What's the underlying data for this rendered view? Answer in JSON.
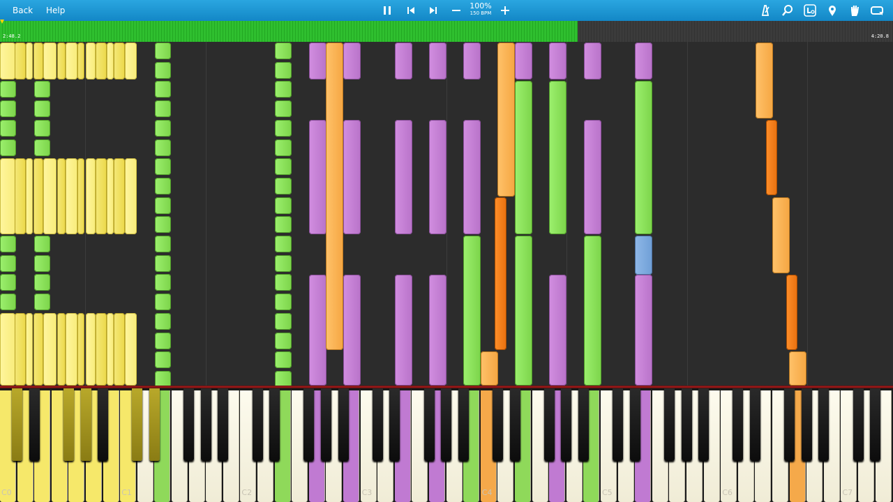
{
  "toolbar": {
    "back_label": "Back",
    "help_label": "Help",
    "speed_percent": "100%",
    "tempo": "150 BPM",
    "icons": [
      "pause-icon",
      "skip-back-icon",
      "skip-forward-icon",
      "minus-icon",
      "plus-icon",
      "metronome-icon",
      "zoom-icon",
      "keyboard-label-icon",
      "location-pin-icon",
      "hand-icon",
      "loop-icon"
    ]
  },
  "progress": {
    "current_time": "2:48.2",
    "total_time": "4:20.8",
    "fraction": 0.647
  },
  "keyboard": {
    "octave_labels": [
      "C0",
      "C1",
      "C2",
      "C3",
      "C4",
      "C5",
      "C6",
      "C7"
    ]
  },
  "colors": {
    "toolbar": "#1a95d4",
    "progress_played": "#2fbf2f",
    "yellow_track": "#f4e878",
    "green_track": "#9cf06e",
    "purple_track": "#c885d9",
    "orange_track": "#ffc26a",
    "dark_orange_track": "#ff8f2a",
    "blue_track": "#8fb8e8"
  }
}
